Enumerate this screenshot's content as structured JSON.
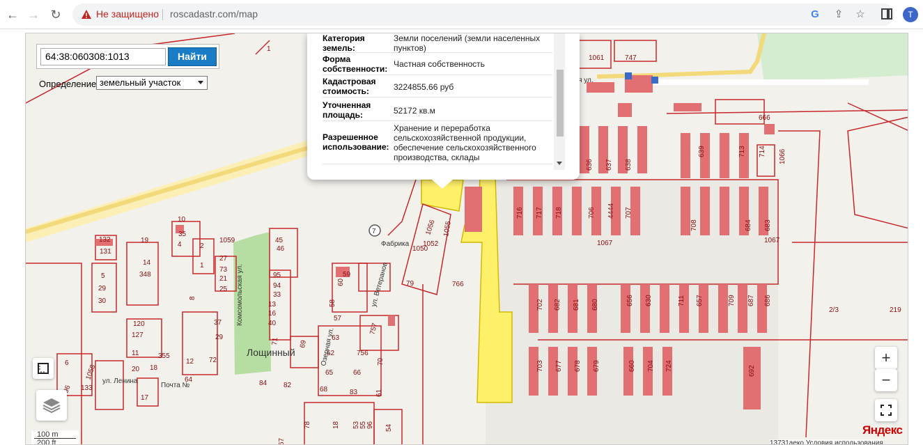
{
  "browser": {
    "insecure_label": "Не защищено",
    "url": "roscadastr.com/map",
    "profile_initial": "T"
  },
  "search": {
    "value": "64:38:060308:1013",
    "button_label": "Найти",
    "definition_label": "Определение:",
    "definition_value": "земельный участок"
  },
  "popup": {
    "rows": [
      {
        "key": "Категория земель:",
        "value": "Земли поселений (земли населенных пунктов)"
      },
      {
        "key": "Форма собственности:",
        "value": "Частная собственность"
      },
      {
        "key": "Кадастровая стоимость:",
        "value": "3224855.66 руб"
      },
      {
        "key": "Уточненная площадь:",
        "value": "52172 кв.м"
      },
      {
        "key": "Разрешенное использование:",
        "value": "Хранение и переработка сельскохозяйственной продукции, обеспечение сельскохозяйственного производства, склады"
      }
    ]
  },
  "map": {
    "town_name": "Лощинный",
    "scale_label": "100 m",
    "scale_label_2": "200 ft",
    "provider": "Яндекс",
    "copyright": "13731аеко  Условия использования",
    "street_labels": [
      "ул. Ленина",
      "Комсомольская ул.",
      "ул. Ветеранов",
      "Озерная ул.",
      "Фабрика",
      "Почта №",
      "ная ул."
    ],
    "parcel_numbers": [
      "1061",
      "747",
      "666",
      "1066",
      "639",
      "713",
      "714",
      "636",
      "637",
      "638",
      "716",
      "717",
      "718",
      "706",
      "4444",
      "707",
      "708",
      "684",
      "683",
      "1067",
      "1067",
      "702",
      "682",
      "681",
      "680",
      "656",
      "630",
      "711",
      "657",
      "709",
      "687",
      "686",
      "703",
      "677",
      "678",
      "679",
      "660",
      "704",
      "724",
      "692",
      "766",
      "1056",
      "1055",
      "1052",
      "1050",
      "79",
      "59",
      "60",
      "58",
      "57",
      "63",
      "757",
      "756",
      "62",
      "65",
      "66",
      "70",
      "68",
      "83",
      "61",
      "54",
      "1059",
      "45",
      "46",
      "95",
      "94",
      "33",
      "13",
      "16",
      "40",
      "71",
      "69",
      "84",
      "82",
      "132",
      "131",
      "5",
      "29",
      "30",
      "19",
      "14",
      "348",
      "10",
      "35",
      "4",
      "2",
      "1",
      "27",
      "73",
      "21",
      "25",
      "37",
      "29",
      "120",
      "127",
      "11",
      "355",
      "12",
      "72",
      "64",
      "20",
      "18",
      "17",
      "6",
      "1058",
      "133",
      "96",
      "78",
      "18",
      "53",
      "55",
      "96",
      "67",
      "2/3",
      "219",
      "1"
    ],
    "zoom_in": "+",
    "zoom_out": "−"
  }
}
